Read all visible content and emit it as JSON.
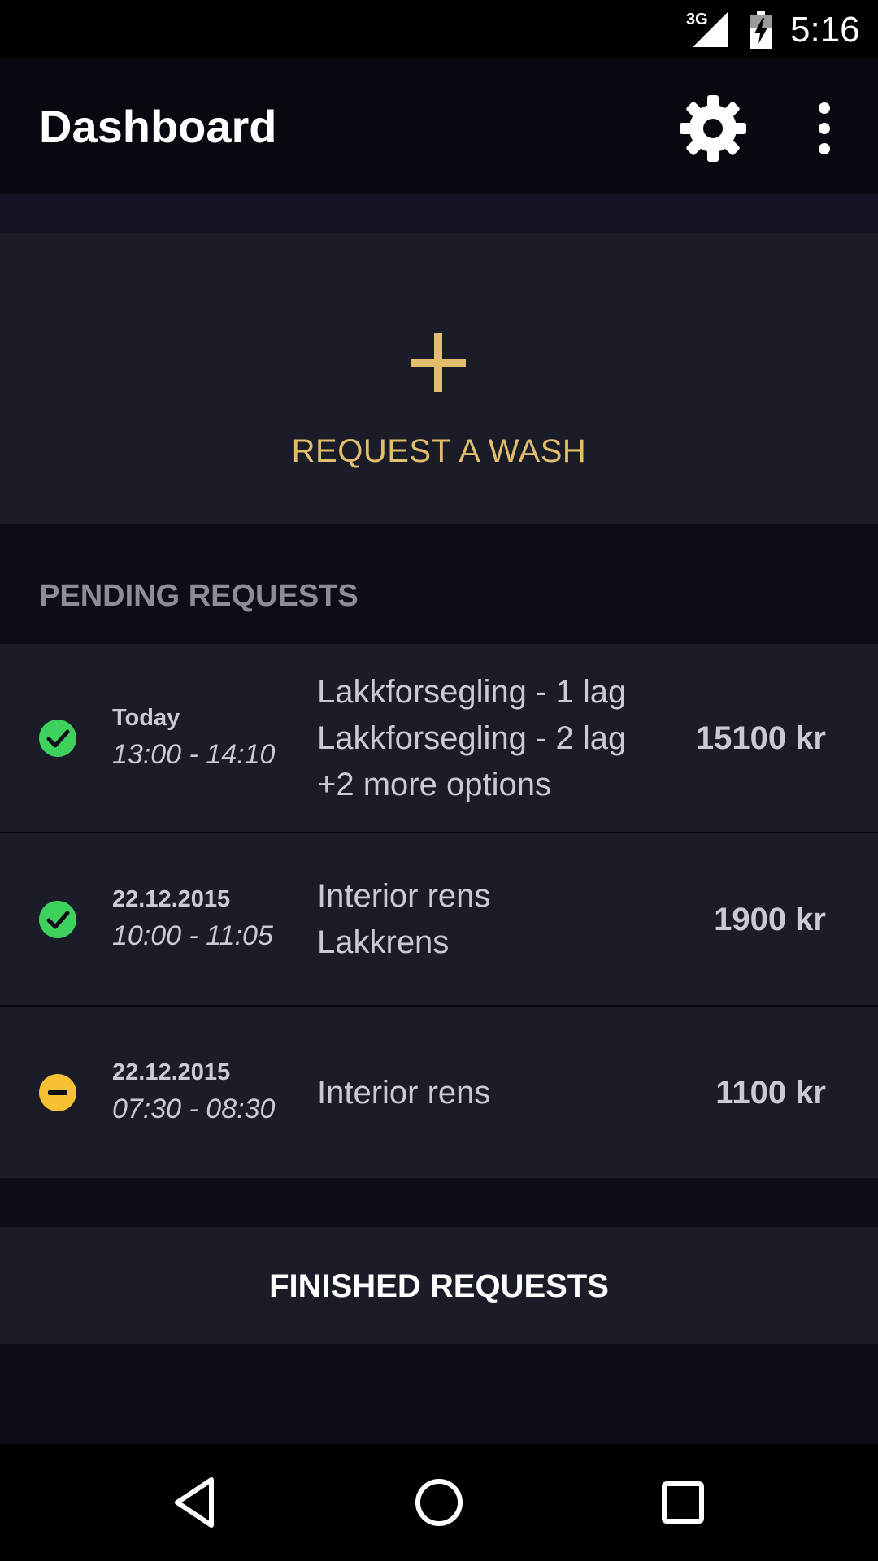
{
  "status_bar": {
    "network": "3G",
    "time": "5:16"
  },
  "app_bar": {
    "title": "Dashboard",
    "settings_icon": "gear-icon",
    "more_icon": "more-vert-icon"
  },
  "request_card": {
    "icon": "plus-icon",
    "label": "REQUEST A WASH"
  },
  "pending": {
    "title": "PENDING REQUESTS",
    "items": [
      {
        "status": "confirmed",
        "status_icon": "check-circle-icon",
        "date": "Today",
        "time": "13:00 - 14:10",
        "options": [
          "Lakkforsegling - 1 lag",
          "Lakkforsegling - 2 lag",
          "+2 more options"
        ],
        "price": "15100 kr"
      },
      {
        "status": "confirmed",
        "status_icon": "check-circle-icon",
        "date": "22.12.2015",
        "time": "10:00 - 11:05",
        "options": [
          "Interior rens",
          "Lakkrens"
        ],
        "price": "1900 kr"
      },
      {
        "status": "pending",
        "status_icon": "minus-circle-icon",
        "date": "22.12.2015",
        "time": "07:30 - 08:30",
        "options": [
          "Interior rens"
        ],
        "price": "1100 kr"
      }
    ]
  },
  "finished": {
    "label": "FINISHED REQUESTS"
  },
  "nav_bar": {
    "back_icon": "back-triangle-icon",
    "home_icon": "home-circle-icon",
    "recents_icon": "recents-square-icon"
  },
  "colors": {
    "accent": "#e2bd6b",
    "confirmed": "#3fd15d",
    "pending": "#f6c233",
    "card": "#1a1c28",
    "background": "#0c0d16"
  }
}
